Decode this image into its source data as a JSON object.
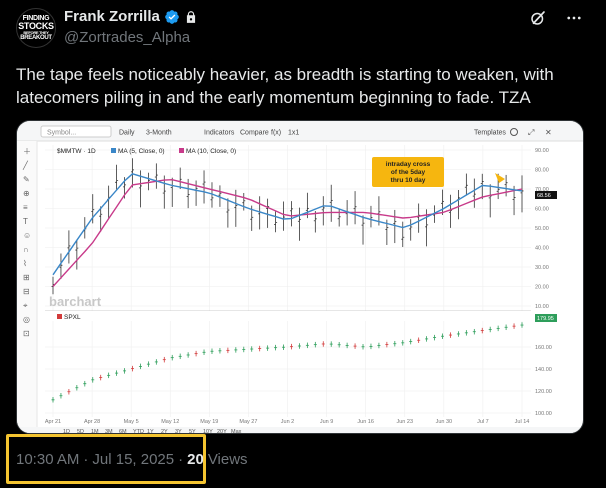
{
  "author": {
    "display_name": "Frank Zorrilla",
    "handle": "@Zortrades_Alpha",
    "avatar_lines": [
      "FINDING",
      "STOCKS",
      "BEFORE THEY",
      "BREAKOUT"
    ]
  },
  "tweet": {
    "text": "The tape feels noticeably heavier, as breadth is starting to weaken, with latecomers piling in and the early momentum beginning to fade. TZA"
  },
  "meta": {
    "time": "10:30 AM",
    "separator": "·",
    "date": "Jul 15, 2025",
    "views_count": "20",
    "views_label": "Views"
  },
  "chart_image": {
    "toolbar": {
      "search_placeholder": "Symbol...",
      "interval": "Daily",
      "range": "3-Month",
      "indicators": "Indicators",
      "compare": "Compare",
      "fx": "f(x)",
      "ratio": "1x1",
      "templates": "Templates"
    },
    "upper_legend": {
      "symbol": "$MMTW",
      "interval": "1D",
      "ma5": "MA (5, Close, 0)",
      "ma10": "MA (10, Close, 0)"
    },
    "lower_legend": {
      "symbol": "SPXL"
    },
    "annotation": [
      "intraday cross",
      "of the 5day",
      "thru 10 day"
    ],
    "watermark": "barchart",
    "upper_yticks": [
      "90.00",
      "80.00",
      "70.00",
      "60.00",
      "50.00",
      "40.00",
      "30.00",
      "20.00",
      "10.00"
    ],
    "upper_last_labels": [
      "68.56"
    ],
    "lower_yticks": [
      "160.00",
      "140.00",
      "120.00",
      "100.00"
    ],
    "lower_last_label": "179.95",
    "x_ticks": [
      "Apr 21",
      "Apr 28",
      "May 5",
      "May 12",
      "May 19",
      "May 27",
      "Jun 2",
      "Jun 9",
      "Jun 16",
      "Jun 23",
      "Jun 30",
      "Jul 7",
      "Jul 14"
    ],
    "range_buttons": [
      "1D",
      "5D",
      "1M",
      "3M",
      "6M",
      "YTD",
      "1Y",
      "2Y",
      "3Y",
      "5Y",
      "10Y",
      "20Y",
      "Max"
    ],
    "colors": {
      "ma5": "#3a87c8",
      "ma10": "#c83a8a",
      "up": "#2e9e5b",
      "down": "#d23b3b",
      "annotation_bg": "#f6b60f"
    }
  },
  "chart_data": [
    {
      "type": "line",
      "title": "$MMTW",
      "x": [
        "Apr 21",
        "Apr 28",
        "May 5",
        "May 12",
        "May 19",
        "May 27",
        "Jun 2",
        "Jun 9",
        "Jun 16",
        "Jun 23",
        "Jun 30",
        "Jul 7",
        "Jul 14"
      ],
      "series": [
        {
          "name": "MA (5, Close, 0)",
          "values": [
            26,
            55,
            78,
            72,
            68,
            60,
            54,
            62,
            55,
            50,
            60,
            72,
            69
          ]
        },
        {
          "name": "MA (10, Close, 0)",
          "values": [
            20,
            42,
            72,
            75,
            70,
            65,
            56,
            58,
            58,
            55,
            58,
            66,
            70
          ]
        }
      ],
      "ylim": [
        10,
        90
      ],
      "grid": true
    },
    {
      "type": "line",
      "title": "SPXL",
      "x": [
        "Apr 21",
        "Apr 28",
        "May 5",
        "May 12",
        "May 19",
        "May 27",
        "Jun 2",
        "Jun 9",
        "Jun 16",
        "Jun 23",
        "Jun 30",
        "Jul 7",
        "Jul 14"
      ],
      "series": [
        {
          "values": [
            112,
            130,
            140,
            150,
            156,
            158,
            160,
            163,
            160,
            164,
            170,
            175,
            179.95
          ]
        }
      ],
      "ylim": [
        100,
        180
      ],
      "grid": true
    }
  ]
}
